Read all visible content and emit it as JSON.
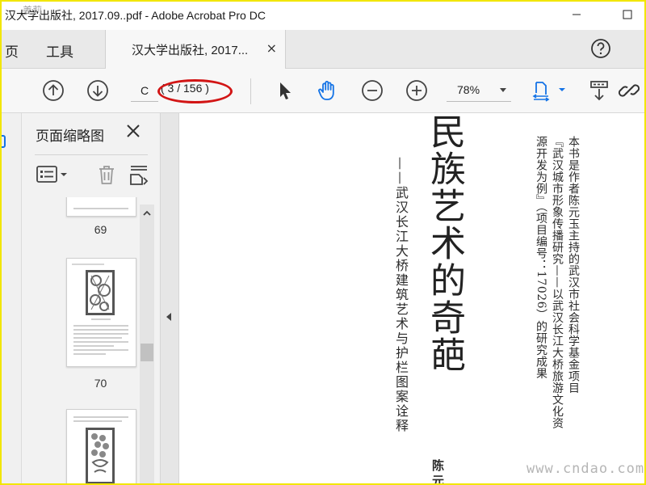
{
  "window": {
    "title": "汉大学出版社, 2017.09..pdf - Adobe Acrobat Pro DC",
    "title_overlay": "姜莉"
  },
  "menu": {
    "home_partial": "页",
    "tools": "工具"
  },
  "tab": {
    "label": "汉大学出版社, 2017...",
    "close": "×"
  },
  "toolbar": {
    "page_input": "C",
    "page_count": "( 3 / 156 )",
    "zoom": "78%"
  },
  "panel": {
    "title": "页面缩略图",
    "thumbnails": [
      {
        "label": "69"
      },
      {
        "label": "70"
      },
      {
        "label": ""
      }
    ]
  },
  "document": {
    "title": "民族艺术的奇葩",
    "subtitle": "——武汉长江大桥建筑艺术与护栏图案诠释",
    "author": "陈元",
    "note_lines": [
      "本书是作者陈元玉主持的武汉市社会科学基金项目",
      "『武汉城市形象传播研究——以武汉长江大桥旅游文化资",
      "源开发为例』（项目编号：17026）的研究成果"
    ]
  },
  "watermark": "www.cndao.com",
  "colors": {
    "acrobat_blue": "#1473e6",
    "highlight_red": "#d21515",
    "frame_yellow": "#f2e600"
  }
}
